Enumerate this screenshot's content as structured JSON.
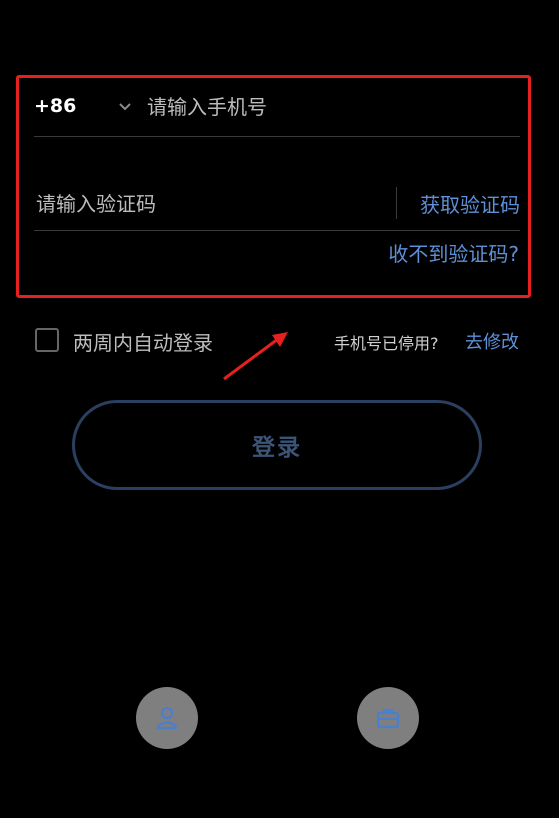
{
  "phone": {
    "country_code": "+86",
    "placeholder": "请输入手机号",
    "value": ""
  },
  "code": {
    "placeholder": "请输入验证码",
    "value": "",
    "get_code_label": "获取验证码",
    "no_code_label": "收不到验证码?"
  },
  "remember": {
    "label": "两周内自动登录",
    "checked": false
  },
  "phone_disabled": {
    "text": "手机号已停用?",
    "link_label": "去修改"
  },
  "login": {
    "label": "登录"
  },
  "bottom_buttons": [
    {
      "icon": "user-icon"
    },
    {
      "icon": "briefcase-icon"
    }
  ],
  "colors": {
    "background": "#000000",
    "accent": "#5d90d6",
    "highlight": "#e5201f",
    "login_border": "#2b3f60"
  }
}
